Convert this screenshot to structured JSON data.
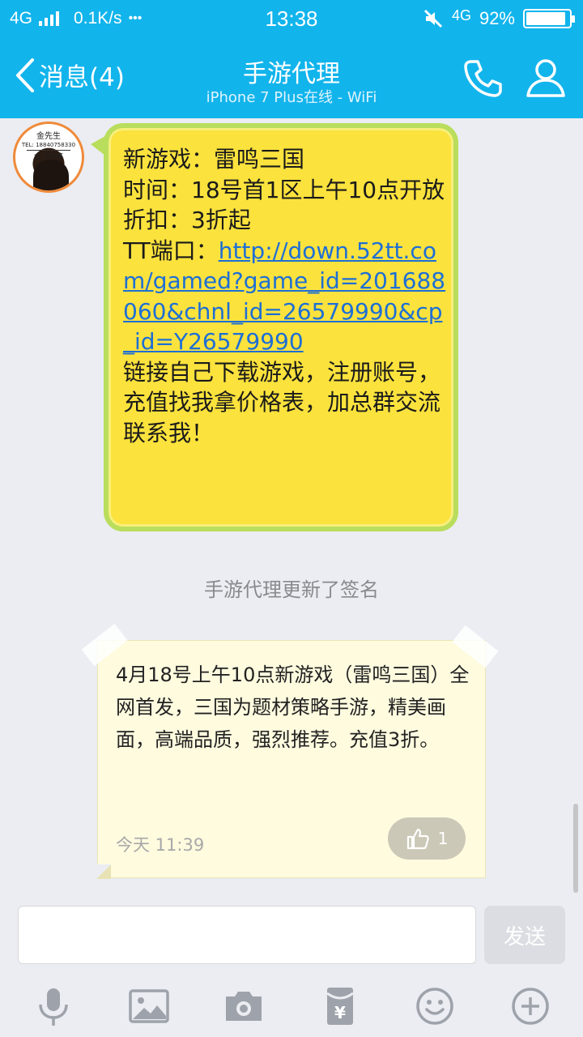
{
  "status_bar": {
    "network": "4G",
    "speed": "0.1K/s",
    "more": "•••",
    "time": "13:38",
    "network_right": "4G",
    "battery_percent": "92%",
    "battery_level": 0.92
  },
  "header": {
    "back_label": "消息(4)",
    "title": "手游代理",
    "subtitle": "iPhone 7 Plus在线 - WiFi",
    "icons": [
      "phone-icon",
      "profile-icon"
    ]
  },
  "avatar": {
    "name": "金先生",
    "tel": "TEL: 18840758330",
    "brand": "金戈网络"
  },
  "message": {
    "line1": "新游戏：雷鸣三国",
    "line2": "时间：18号首1区上午10点开放",
    "line3": "折扣：3折起",
    "port_label": "TT端口：",
    "link": "http://down.52tt.com/gamed?game_id=201688060&chnl_id=26579990&cp_id=Y26579990",
    "line5": "链接自己下载游戏，注册账号，充值找我拿价格表，加总群交流联系我！"
  },
  "system_note": "手游代理更新了签名",
  "signature_card": {
    "text": "4月18号上午10点新游戏（雷鸣三国）全网首发，三国为题材策略手游，精美画面，高端品质，强烈推荐。充值3折。",
    "time": "今天 11:39",
    "likes": "1"
  },
  "composer": {
    "input_value": "",
    "send_label": "发送"
  },
  "toolbar": {
    "icons": [
      "microphone-icon",
      "image-icon",
      "camera-icon",
      "red-packet-icon",
      "emoji-icon",
      "plus-icon"
    ],
    "red_packet_symbol": "¥"
  },
  "colors": {
    "accent": "#12b4ec",
    "bubble": "#fbe23d",
    "bubble_border": "#b9dd5c",
    "link": "#1d6fd6",
    "note_card": "#fefbdf"
  }
}
